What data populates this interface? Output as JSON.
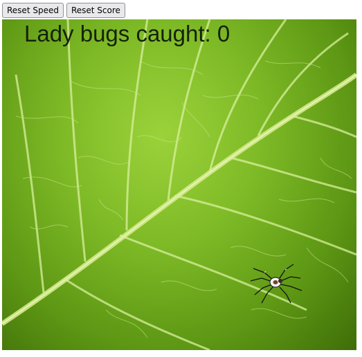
{
  "toolbar": {
    "reset_speed_label": "Reset Speed",
    "reset_score_label": "Reset Score"
  },
  "game": {
    "score_label": "Lady bugs caught: 0",
    "score_value": 0,
    "background": "leaf",
    "player_icon": "spider-icon"
  },
  "colors": {
    "leaf_light": "#9bd23a",
    "leaf_dark": "#3e6d08",
    "vein": "#d8ef9a",
    "text": "#15210a"
  }
}
